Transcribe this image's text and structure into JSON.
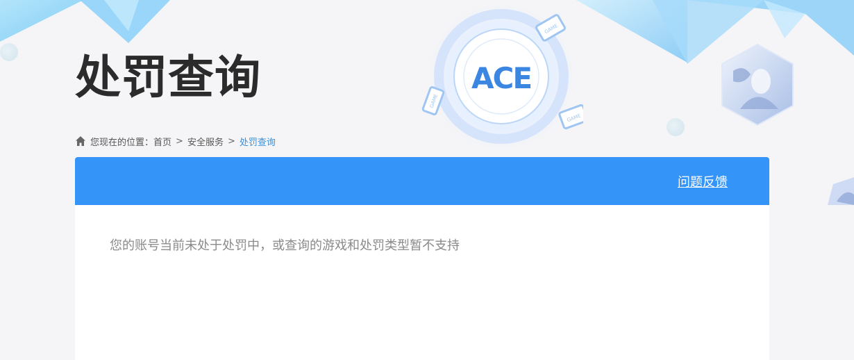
{
  "page": {
    "title": "处罚查询"
  },
  "breadcrumb": {
    "prefix": "您现在的位置：",
    "items": [
      {
        "label": "首页"
      },
      {
        "label": "安全服务"
      },
      {
        "label": "处罚查询"
      }
    ],
    "separator": ">"
  },
  "panel": {
    "feedback_label": "问题反馈",
    "message": "您的账号当前未处于处罚中，或查询的游戏和处罚类型暂不支持"
  },
  "decor": {
    "logo_text": "ACE",
    "game_badge": "GAME"
  },
  "colors": {
    "header_blue": "#3594f8",
    "link_blue": "#3a8fd8",
    "title": "#2b2b2b",
    "message": "#8a8a8a",
    "background": "#f5f5f7"
  }
}
